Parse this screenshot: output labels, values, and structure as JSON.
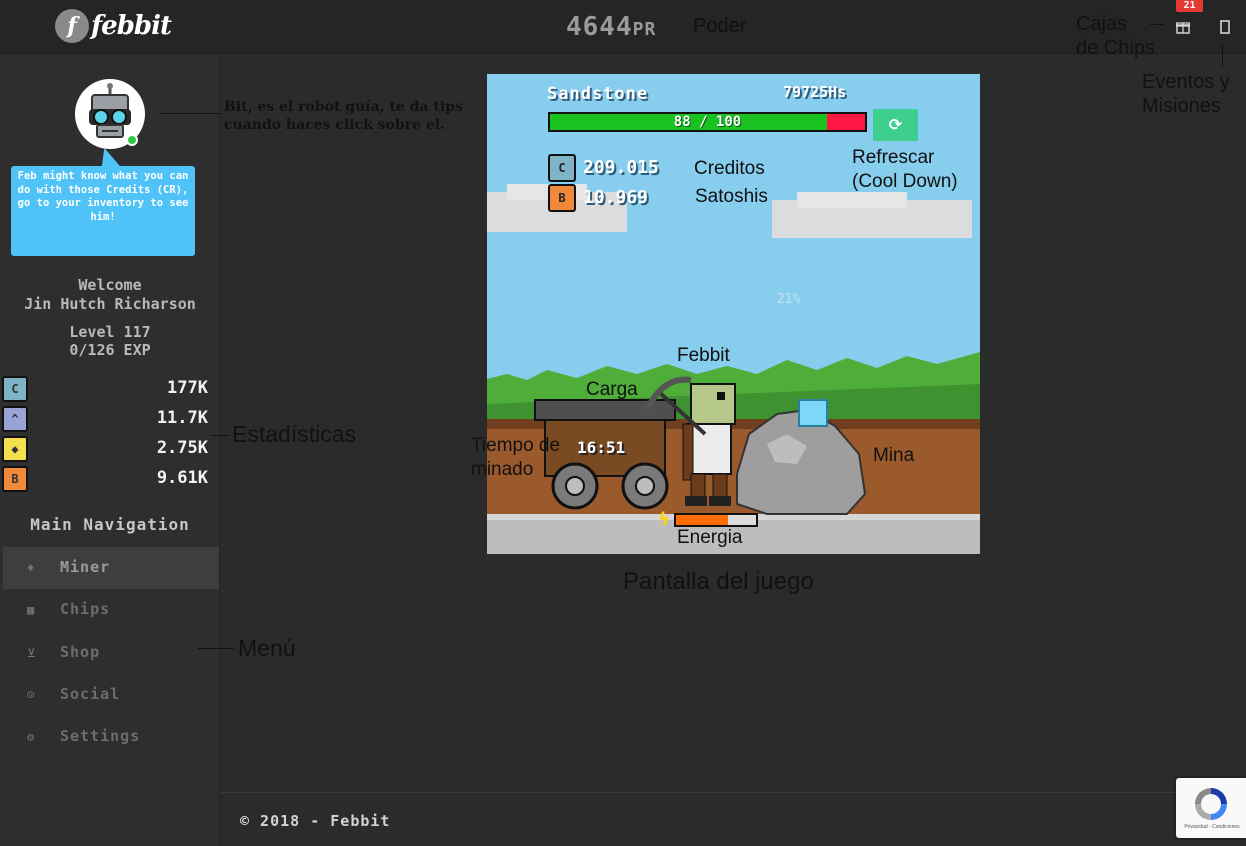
{
  "header": {
    "logo_mark": "f",
    "logo_text": "febbit",
    "power_value": "4644",
    "power_unit": "PR",
    "power_label": "Poder",
    "gift_badge": "21",
    "gift_icon": "gift-icon",
    "events_icon": "events-icon"
  },
  "annotations": {
    "chip_boxes": "Cajas\nde Chips",
    "chip_boxes_line1": "Cajas",
    "chip_boxes_line2": "de Chips",
    "events_line1": "Eventos y",
    "events_line2": "Misiones",
    "bit_line1": "Bit, es el robot guía, te da tips",
    "bit_line2": "cuando haces click sobre el.",
    "stats": "Estadísticas",
    "menu": "Menú",
    "refresh_line1": "Refrescar",
    "refresh_line2": "(Cool Down)",
    "credits": "Creditos",
    "satoshis": "Satoshis",
    "febbit": "Febbit",
    "load": "Carga",
    "mining_time_line1": "Tiempo de",
    "mining_time_line2": "minado",
    "mine": "Mina",
    "energy": "Energia",
    "game_screen": "Pantalla del juego"
  },
  "sidebar": {
    "bubble_text": "Feb might know what you can do with those Credits (CR), go to your inventory to see him!",
    "welcome": "Welcome",
    "username": "Jin Hutch Richarson",
    "level": "Level 117",
    "exp": "0/126 EXP",
    "stats": [
      {
        "icon": "credits-icon",
        "glyph": "C",
        "value": "177K",
        "color": "#7fb3c8"
      },
      {
        "icon": "hashpower-icon",
        "glyph": "^",
        "value": "11.7K",
        "color": "#9aa3d6"
      },
      {
        "icon": "gem-icon",
        "glyph": "◆",
        "value": "2.75K",
        "color": "#f4e04d"
      },
      {
        "icon": "satoshi-icon",
        "glyph": "B",
        "value": "9.61K",
        "color": "#f08a3a"
      }
    ],
    "nav_heading": "Main Navigation",
    "nav": [
      {
        "label": "Miner",
        "icon": "diamond-icon",
        "glyph": "♦"
      },
      {
        "label": "Chips",
        "icon": "grid-icon",
        "glyph": "▦"
      },
      {
        "label": "Shop",
        "icon": "cart-icon",
        "glyph": "⊻"
      },
      {
        "label": "Social",
        "icon": "users-icon",
        "glyph": "☺"
      },
      {
        "label": "Settings",
        "icon": "wrench-icon",
        "glyph": "⚙"
      }
    ]
  },
  "game": {
    "mine_name": "Sandstone",
    "hashrate": "79725Hs",
    "progress_text": "88 / 100",
    "progress_value": 0.88,
    "refresh_glyph": "⟳",
    "credits_value": "209.015",
    "satoshis_value": "10.969",
    "percent": "21%",
    "timer": "16:51",
    "energy_value": 0.65
  },
  "footer": {
    "copyright": "© 2018 - Febbit"
  },
  "recaptcha": {
    "text": "Privacidad - Condiciones"
  }
}
